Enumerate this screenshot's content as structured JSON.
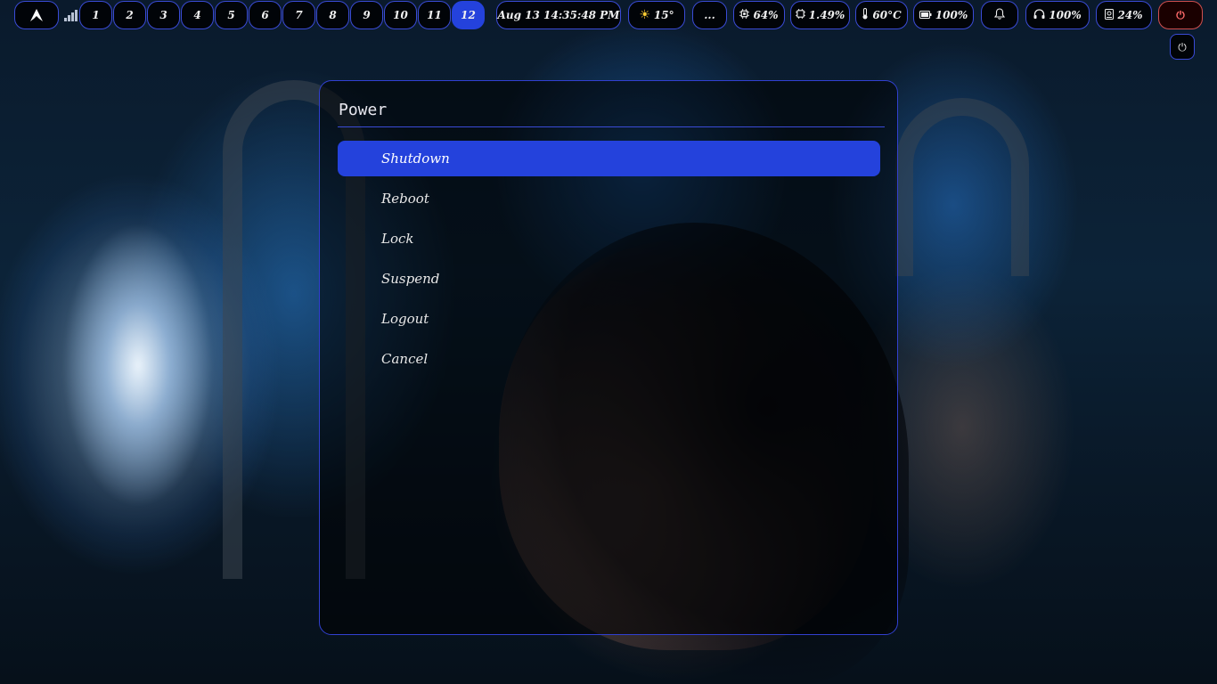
{
  "workspaces": [
    {
      "label": "1"
    },
    {
      "label": "2"
    },
    {
      "label": "3"
    },
    {
      "label": "4"
    },
    {
      "label": "5"
    },
    {
      "label": "6"
    },
    {
      "label": "7"
    },
    {
      "label": "8"
    },
    {
      "label": "9"
    },
    {
      "label": "10"
    },
    {
      "label": "11"
    },
    {
      "label": "12",
      "active": true
    }
  ],
  "status": {
    "datetime": "Aug 13 14:35:48 PM",
    "weather": "15°",
    "more": "...",
    "cpu": "64%",
    "memory": "1.49%",
    "temperature": "60°C",
    "battery": "100%",
    "headset": "100%",
    "disk": "24%"
  },
  "icons": {
    "launcher": "arch-logo-icon",
    "signal": "signal-bars-icon",
    "weather": "sun-icon",
    "cpu": "cpu-chip-icon",
    "memory": "memory-chip-icon",
    "temperature": "thermometer-icon",
    "battery": "battery-icon",
    "notifications": "bell-icon",
    "headset": "headset-icon",
    "disk": "disk-icon",
    "power": "power-icon"
  },
  "power_menu": {
    "title": "Power",
    "items": [
      {
        "label": "Shutdown",
        "selected": true
      },
      {
        "label": "Reboot"
      },
      {
        "label": "Lock"
      },
      {
        "label": "Suspend"
      },
      {
        "label": "Logout"
      },
      {
        "label": "Cancel"
      }
    ]
  },
  "colors": {
    "accent": "#2442dc",
    "border": "#3a4bd6",
    "power_border": "#d05050"
  }
}
